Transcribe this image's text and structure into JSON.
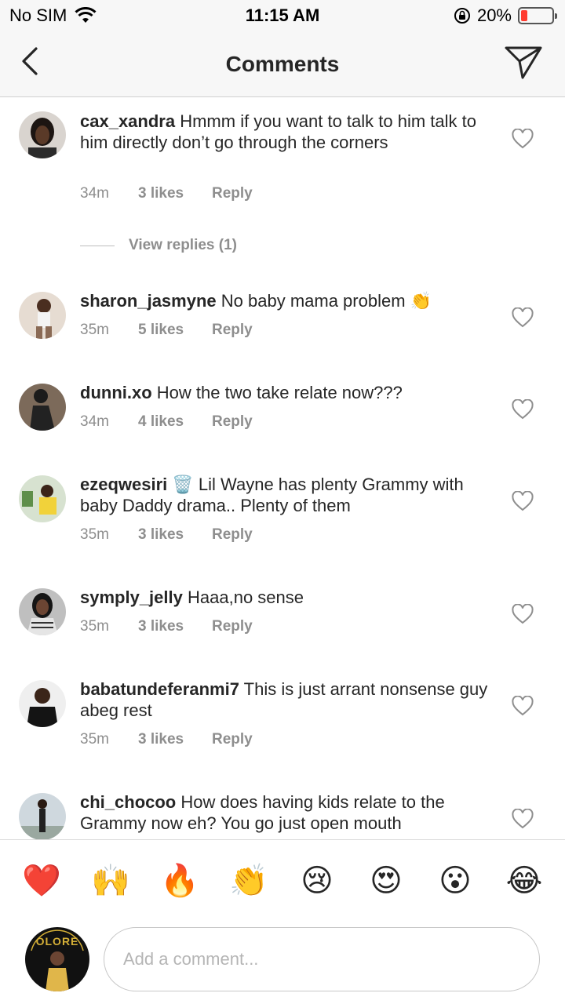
{
  "status_bar": {
    "carrier": "No SIM",
    "time": "11:15 AM",
    "battery": "20%",
    "battery_level": 0.2,
    "battery_color": "#ff3b30"
  },
  "nav": {
    "title": "Comments"
  },
  "comments": [
    {
      "username": "cax_xandra",
      "text": "Hmmm if you want to talk to him talk to him directly don’t go through the corners",
      "time": "34m",
      "likes": "3 likes",
      "reply": "Reply",
      "view_replies": "View replies (1)"
    },
    {
      "username": "sharon_jasmyne",
      "text": "No baby mama problem 👏",
      "time": "35m",
      "likes": "5 likes",
      "reply": "Reply"
    },
    {
      "username": "dunni.xo",
      "text": "How the two take relate now???",
      "time": "34m",
      "likes": "4 likes",
      "reply": "Reply"
    },
    {
      "username": "ezeqwesiri 🗑️",
      "text": "Lil Wayne has plenty Grammy with baby Daddy drama.. Plenty of them",
      "time": "35m",
      "likes": "3 likes",
      "reply": "Reply"
    },
    {
      "username": "symply_jelly",
      "text": "Haaa,no sense",
      "time": "35m",
      "likes": "3 likes",
      "reply": "Reply"
    },
    {
      "username": "babatundeferanmi7",
      "text": "This is just arrant nonsense guy abeg rest",
      "time": "35m",
      "likes": "3 likes",
      "reply": "Reply"
    },
    {
      "username": "chi_chocoo",
      "text": "How does having kids relate to the Grammy now eh? You go just open mouth",
      "time": "",
      "likes": "",
      "reply": ""
    }
  ],
  "emoji_bar": [
    "❤️",
    "🙌",
    "🔥",
    "👏",
    "😢",
    "😍",
    "😮",
    "😂"
  ],
  "input": {
    "placeholder": "Add a comment...",
    "avatar_text": "OLORE"
  },
  "icons": {
    "back": "chevron-left-icon",
    "send": "paper-plane-icon",
    "heart": "heart-outline-icon"
  }
}
